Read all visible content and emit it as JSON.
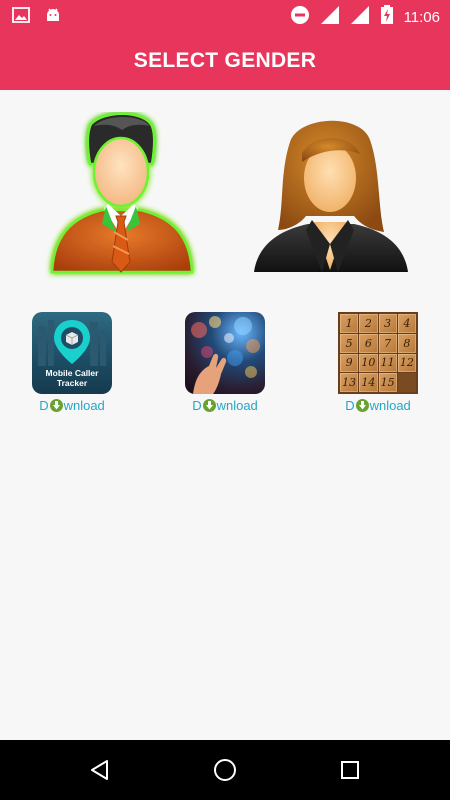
{
  "status_bar": {
    "time": "11:06",
    "icons": [
      "image-icon",
      "android-icon",
      "do-not-disturb-icon",
      "wifi-signal-icon",
      "cell-signal-icon",
      "battery-charging-icon"
    ]
  },
  "app_bar": {
    "title": "SELECT GENDER"
  },
  "genders": [
    {
      "name": "male",
      "icon": "male-avatar-icon",
      "selected": true
    },
    {
      "name": "female",
      "icon": "female-avatar-icon",
      "selected": false
    }
  ],
  "promos": [
    {
      "thumb_text_line1": "Mobile Caller",
      "thumb_text_line2": "Tracker",
      "dl_before": "D",
      "dl_after": "wnload"
    },
    {
      "dl_before": "D",
      "dl_after": "wnload"
    },
    {
      "tiles": [
        "1",
        "2",
        "3",
        "4",
        "5",
        "6",
        "7",
        "8",
        "9",
        "10",
        "11",
        "12",
        "13",
        "14",
        "15",
        ""
      ],
      "dl_before": "D",
      "dl_after": "wnload"
    }
  ],
  "colors": {
    "primary": "#e8355c",
    "link": "#26a7c6",
    "download_icon": "#6aa231",
    "selection_glow": "#7dff3a"
  },
  "nav_bar": {
    "buttons": [
      "back-icon",
      "home-icon",
      "recents-icon"
    ]
  }
}
